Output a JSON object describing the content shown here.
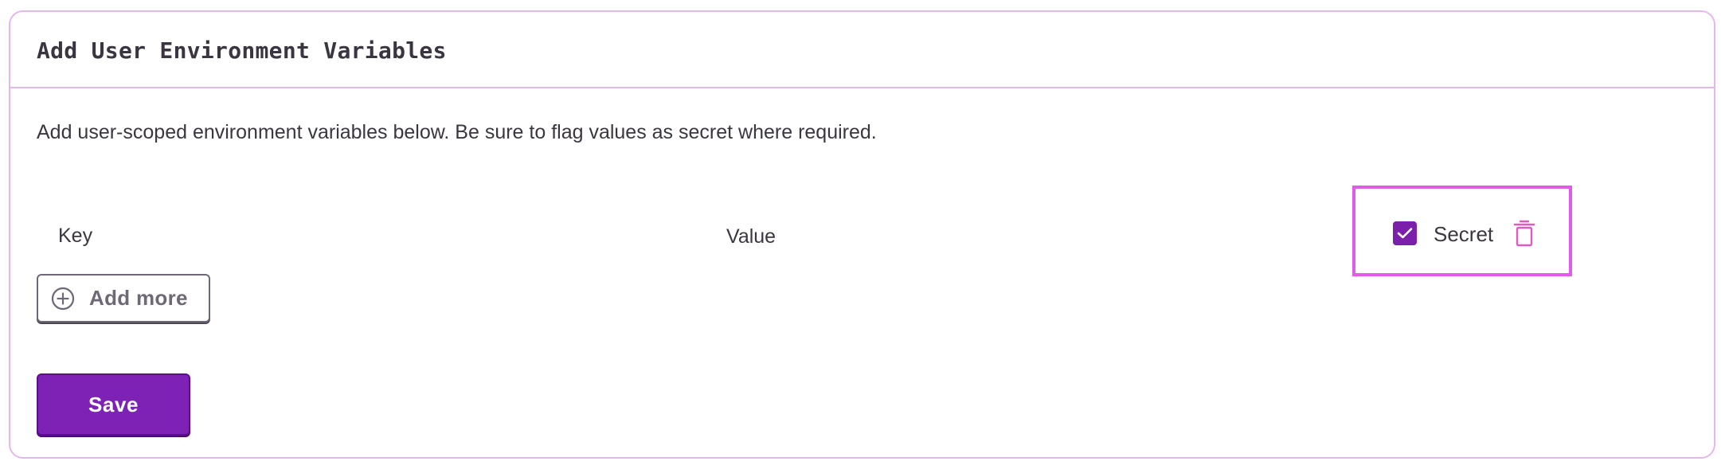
{
  "card": {
    "title": "Add User Environment Variables",
    "description": "Add user-scoped environment variables below. Be sure to flag values as secret where required."
  },
  "env_row": {
    "key_placeholder": "Key",
    "value_placeholder": "Value",
    "secret_label": "Secret",
    "secret_checked": true,
    "checkbox_icon": "check-icon",
    "delete_icon": "trash-icon"
  },
  "actions": {
    "add_more_label": "Add more",
    "add_more_icon": "plus-circle-icon",
    "save_label": "Save"
  },
  "colors": {
    "accent": "#7e22b5",
    "border": "#e6b7ef",
    "highlight": "#e05be6",
    "delete_icon": "#e05bbf"
  }
}
